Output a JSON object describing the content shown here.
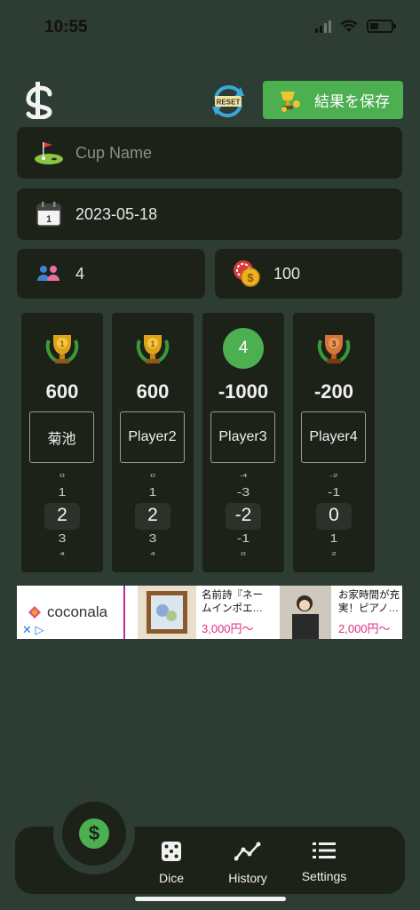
{
  "status_bar": {
    "time": "10:55"
  },
  "header": {
    "reset_label": "RESET",
    "save_label": "結果を保存"
  },
  "form": {
    "cup_name_placeholder": "Cup Name",
    "date": "2023-05-18",
    "player_count": "4",
    "rate": "100"
  },
  "players": [
    {
      "rank": "1",
      "score": "600",
      "name": "菊池",
      "picker": [
        "0",
        "1",
        "2",
        "3",
        "4"
      ]
    },
    {
      "rank": "1",
      "score": "600",
      "name": "Player2",
      "picker": [
        "0",
        "1",
        "2",
        "3",
        "4"
      ]
    },
    {
      "rank": "4",
      "score": "-1000",
      "name": "Player3",
      "picker": [
        "-4",
        "-3",
        "-2",
        "-1",
        "0"
      ]
    },
    {
      "rank": "3",
      "score": "-200",
      "name": "Player4",
      "picker": [
        "-2",
        "-1",
        "0",
        "1",
        "2"
      ]
    }
  ],
  "ad": {
    "brand": "coconala",
    "item1_title": "名前詩『ネー\nムインポエ…",
    "item1_price": "3,000円〜",
    "item2_title": "お家時間が充\n実！ピアノ…",
    "item2_price": "2,000円〜"
  },
  "tabbar": {
    "fab_symbol": "$",
    "tabs": [
      {
        "label": "Dice",
        "icon": "dice-icon"
      },
      {
        "label": "History",
        "icon": "chart-line-icon"
      },
      {
        "label": "Settings",
        "icon": "list-icon"
      }
    ]
  },
  "colors": {
    "background": "#2e3d34",
    "card": "#1d2219",
    "accent": "#4caf50",
    "gold": "#e0a21a",
    "bronze": "#d4763a"
  }
}
